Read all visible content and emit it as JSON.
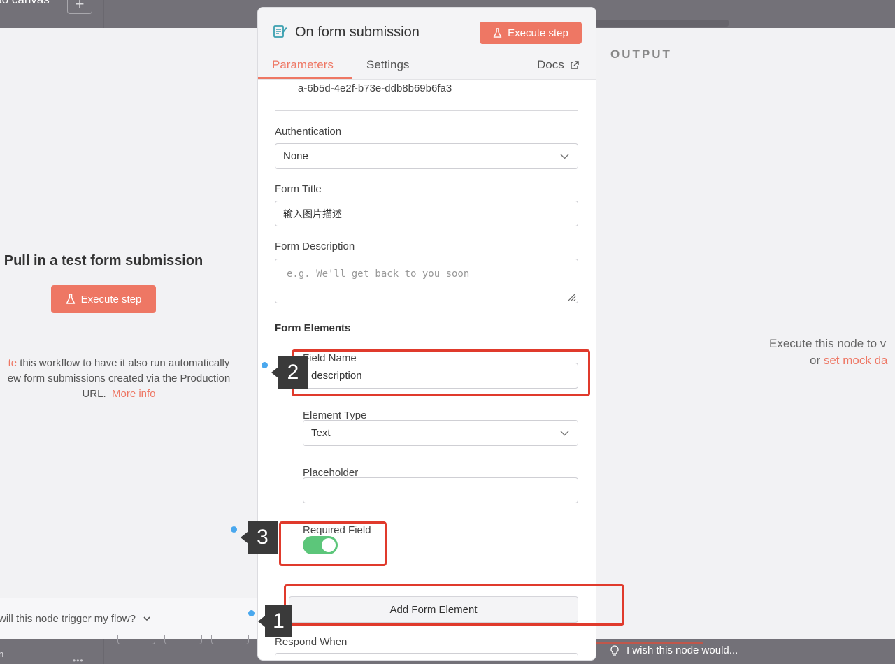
{
  "topbar": {
    "canvas_link": "to canvas",
    "add_symbol": "+"
  },
  "input_pane": {
    "title": "Pull in a test form submission",
    "execute_label": "Execute step",
    "info_prefix": "te",
    "info_text_1": " this workflow to have it also run automatically",
    "info_text_2": "ew form submissions created via the Production",
    "info_text_3": "URL.",
    "more_info": "More info",
    "trigger_question": "will this node trigger my flow?"
  },
  "output_pane": {
    "label": "OUTPUT",
    "line1": "Execute this node to v",
    "or_text": "or ",
    "mock_link": "set mock da"
  },
  "panel": {
    "title": "On form submission",
    "execute_label": "Execute step",
    "tabs": {
      "parameters": "Parameters",
      "settings": "Settings",
      "docs": "Docs"
    },
    "uuid_fragment": "a-6b5d-4e2f-b73e-ddb8b69b6fa3",
    "authentication": {
      "label": "Authentication",
      "value": "None"
    },
    "form_title": {
      "label": "Form Title",
      "value": "输入图片描述"
    },
    "form_description": {
      "label": "Form Description",
      "placeholder": "e.g. We'll get back to you soon"
    },
    "form_elements": {
      "label": "Form Elements",
      "field_name": {
        "label": "Field Name",
        "value": "description"
      },
      "element_type": {
        "label": "Element Type",
        "value": "Text"
      },
      "placeholder": {
        "label": "Placeholder",
        "value": ""
      },
      "required": {
        "label": "Required Field",
        "on": true
      },
      "add_button": "Add Form Element"
    },
    "respond_when": {
      "label": "Respond When"
    }
  },
  "bottombar": {
    "ellipsis": "n",
    "dots": "•••",
    "wish_text": "I wish this node would..."
  },
  "annotations": {
    "badge_1": "1",
    "badge_2": "2",
    "badge_3": "3"
  },
  "colors": {
    "accent": "#ee7764",
    "toggle_on": "#5cc67a",
    "highlight": "#e03a2c",
    "dot": "#4aa8ee",
    "dim_bar": "#737178"
  }
}
